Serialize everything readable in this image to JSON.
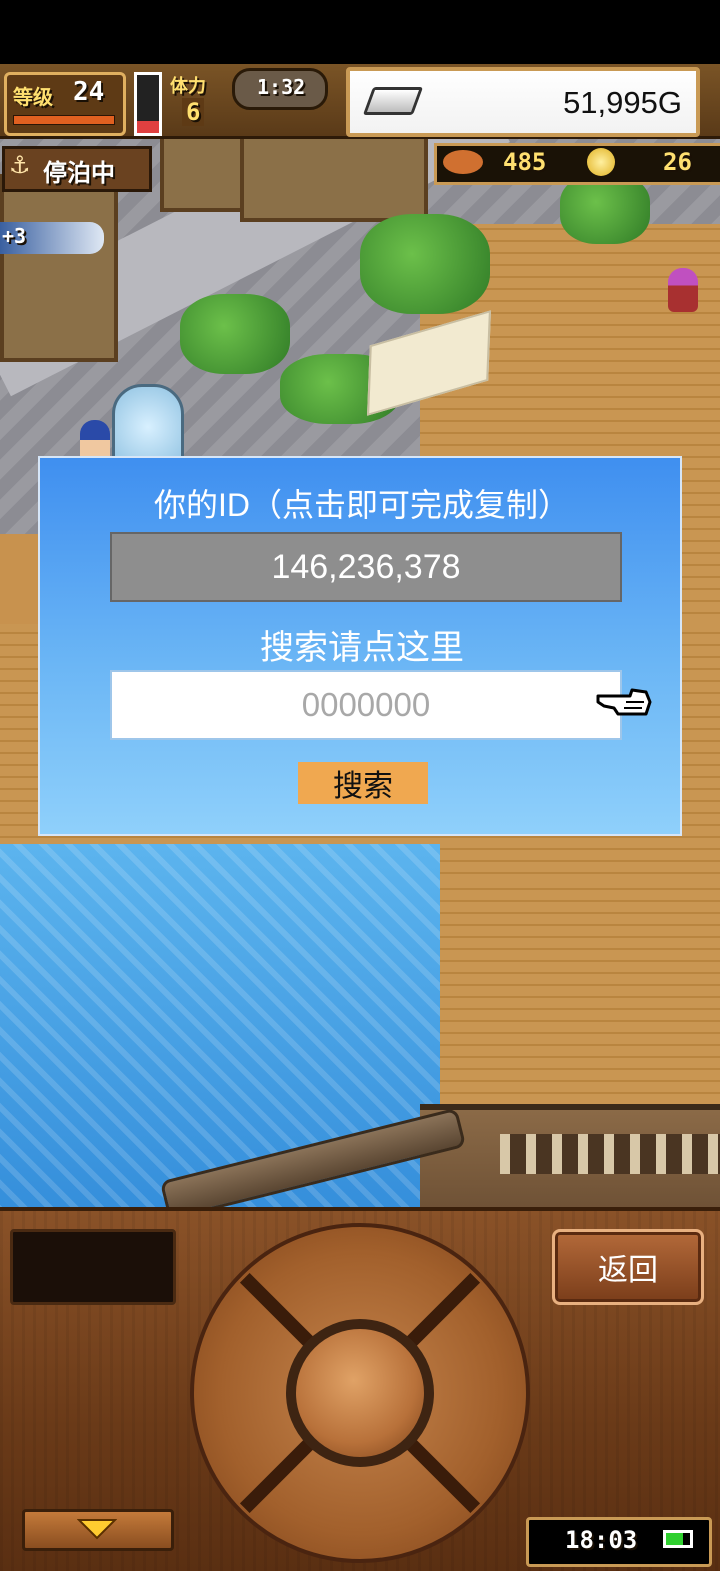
{
  "hud": {
    "level_label": "等级",
    "level_value": "24",
    "stamina_label": "体力",
    "stamina_value": "6",
    "timer": "1:32",
    "gold": "51,995G",
    "anchor_status": "停泊中",
    "food_count": "485",
    "medal_count": "26",
    "side_badge": "+3"
  },
  "dialog": {
    "id_title": "你的ID（点击即可完成复制）",
    "id_value": "146,236,378",
    "search_title": "搜索请点这里",
    "search_placeholder": "0000000",
    "search_button": "搜索"
  },
  "controls": {
    "back_button": "返回",
    "clock": "18:03"
  },
  "colors": {
    "dialog_top": "#3f8ff0",
    "dialog_bottom": "#8fd0fb",
    "search_button": "#f0a850",
    "id_box": "#8e8e8e",
    "panel_wood": "#7a4420"
  }
}
